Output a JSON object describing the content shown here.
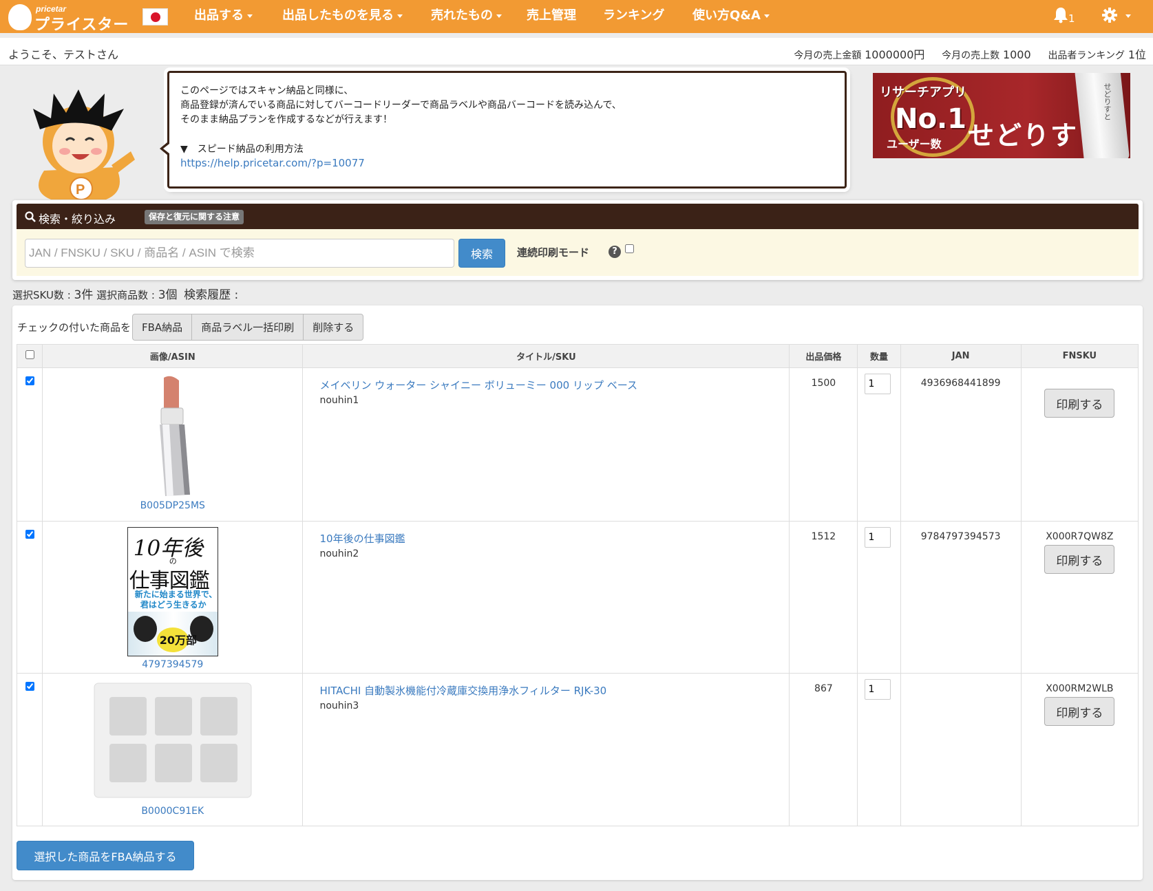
{
  "brand": {
    "small": "pricetar",
    "name": "プライスター"
  },
  "nav": {
    "items": [
      {
        "label": "出品する",
        "has_menu": true
      },
      {
        "label": "出品したものを見る",
        "has_menu": true
      },
      {
        "label": "売れたもの",
        "has_menu": true
      },
      {
        "label": "売上管理",
        "has_menu": false
      },
      {
        "label": "ランキング",
        "has_menu": false
      },
      {
        "label": "使い方Q&A",
        "has_menu": true
      }
    ],
    "notification_count": "1"
  },
  "welcome": {
    "greeting": "ようこそ、テストさん",
    "sales_amount_label": "今月の売上金額",
    "sales_amount": "1000000円",
    "sales_count_label": "今月の売上数",
    "sales_count": "1000",
    "ranking_label": "出品者ランキング",
    "ranking": "1位"
  },
  "info": {
    "lines": [
      "このページではスキャン納品と同様に、",
      "商品登録が済んでいる商品に対してバーコードリーダーで商品ラベルや商品バーコードを読み込んで、",
      "そのまま納品プランを作成するなどが行えます！"
    ],
    "guide": "▼　スピード納品の利用方法",
    "link": "https://help.pricetar.com/?p=10077"
  },
  "banner": {
    "top": "リサーチアプリ",
    "no1": "No.1",
    "users": "ユーザー数",
    "name": "せどりすと",
    "side": "せどりすと"
  },
  "search": {
    "title": "検索・絞り込み",
    "badge": "保存と復元に関する注意",
    "placeholder": "JAN / FNSKU / SKU / 商品名 / ASIN で検索",
    "value": "",
    "button": "検索",
    "continuous_mode": "連続印刷モード",
    "help": "?"
  },
  "summary": {
    "sku_label": "選択SKU数 : ",
    "sku_count": "3件",
    "item_label": " 選択商品数 : ",
    "item_count": "3個",
    "history_label": "検索履歴 :"
  },
  "bulk": {
    "label": "チェックの付いた商品を",
    "fba": "FBA納品",
    "print_labels": "商品ラベル一括印刷",
    "delete": "削除する"
  },
  "table": {
    "headers": {
      "image": "画像/ASIN",
      "title": "タイトル/SKU",
      "price": "出品価格",
      "qty": "数量",
      "jan": "JAN",
      "fnsku": "FNSKU"
    },
    "rows": [
      {
        "checked": true,
        "asin": "B005DP25MS",
        "title": "メイベリン ウォーター シャイニー ボリューミー 000 リップ ベース",
        "sku": "nouhin1",
        "price": "1500",
        "qty": "1",
        "jan": "4936968441899",
        "fnsku": "",
        "print": "印刷する",
        "image": "lipstick"
      },
      {
        "checked": true,
        "asin": "4797394579",
        "title": "10年後の仕事図鑑",
        "sku": "nouhin2",
        "price": "1512",
        "qty": "1",
        "jan": "9784797394573",
        "fnsku": "X000R7QW8Z",
        "print": "印刷する",
        "image": "book"
      },
      {
        "checked": true,
        "asin": "B0000C91EK",
        "title": "HITACHI 自動製氷機能付冷蔵庫交換用浄水フィルター RJK-30",
        "sku": "nouhin3",
        "price": "867",
        "qty": "1",
        "jan": "",
        "fnsku": "X000RM2WLB",
        "print": "印刷する",
        "image": "filter"
      }
    ]
  },
  "book_cover": {
    "line1": "10年後",
    "line2": "の",
    "line3": "仕事図鑑",
    "line4a": "新たに始まる世界で、",
    "line4b": "君はどう生きるか",
    "sticker": "20万部"
  },
  "submit": "選択した商品をFBA納品する",
  "colors": {
    "brand_orange": "#f29a33",
    "panel_brown": "#3b2217",
    "primary_blue": "#428bca",
    "link_blue": "#3a7abf",
    "search_bg": "#fcf8e3"
  }
}
